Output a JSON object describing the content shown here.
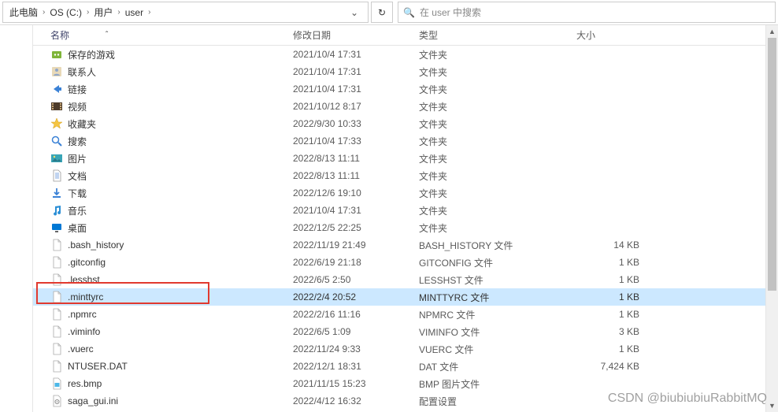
{
  "breadcrumb": {
    "items": [
      "此电脑",
      "OS (C:)",
      "用户",
      "user"
    ]
  },
  "search": {
    "placeholder": "在 user 中搜索"
  },
  "columns": {
    "name": "名称",
    "date": "修改日期",
    "type": "类型",
    "size": "大小"
  },
  "selected_index": 14,
  "highlight_index": 14,
  "items": [
    {
      "icon": "savedgames",
      "name": "保存的游戏",
      "date": "2021/10/4 17:31",
      "type": "文件夹",
      "size": ""
    },
    {
      "icon": "contacts",
      "name": "联系人",
      "date": "2021/10/4 17:31",
      "type": "文件夹",
      "size": ""
    },
    {
      "icon": "links",
      "name": "链接",
      "date": "2021/10/4 17:31",
      "type": "文件夹",
      "size": ""
    },
    {
      "icon": "videos",
      "name": "视频",
      "date": "2021/10/12 8:17",
      "type": "文件夹",
      "size": ""
    },
    {
      "icon": "favorites",
      "name": "收藏夹",
      "date": "2022/9/30 10:33",
      "type": "文件夹",
      "size": ""
    },
    {
      "icon": "searches",
      "name": "搜索",
      "date": "2021/10/4 17:33",
      "type": "文件夹",
      "size": ""
    },
    {
      "icon": "pictures",
      "name": "图片",
      "date": "2022/8/13 11:11",
      "type": "文件夹",
      "size": ""
    },
    {
      "icon": "documents",
      "name": "文档",
      "date": "2022/8/13 11:11",
      "type": "文件夹",
      "size": ""
    },
    {
      "icon": "downloads",
      "name": "下载",
      "date": "2022/12/6 19:10",
      "type": "文件夹",
      "size": ""
    },
    {
      "icon": "music",
      "name": "音乐",
      "date": "2021/10/4 17:31",
      "type": "文件夹",
      "size": ""
    },
    {
      "icon": "desktop",
      "name": "桌面",
      "date": "2022/12/5 22:25",
      "type": "文件夹",
      "size": ""
    },
    {
      "icon": "file",
      "name": ".bash_history",
      "date": "2022/11/19 21:49",
      "type": "BASH_HISTORY 文件",
      "size": "14 KB"
    },
    {
      "icon": "file",
      "name": ".gitconfig",
      "date": "2022/6/19 21:18",
      "type": "GITCONFIG 文件",
      "size": "1 KB"
    },
    {
      "icon": "file",
      "name": ".lesshst",
      "date": "2022/6/5 2:50",
      "type": "LESSHST 文件",
      "size": "1 KB"
    },
    {
      "icon": "file",
      "name": ".minttyrc",
      "date": "2022/2/4 20:52",
      "type": "MINTTYRC 文件",
      "size": "1 KB"
    },
    {
      "icon": "file",
      "name": ".npmrc",
      "date": "2022/2/16 11:16",
      "type": "NPMRC 文件",
      "size": "1 KB"
    },
    {
      "icon": "file",
      "name": ".viminfo",
      "date": "2022/6/5 1:09",
      "type": "VIMINFO 文件",
      "size": "3 KB"
    },
    {
      "icon": "file",
      "name": ".vuerc",
      "date": "2022/11/24 9:33",
      "type": "VUERC 文件",
      "size": "1 KB"
    },
    {
      "icon": "file",
      "name": "NTUSER.DAT",
      "date": "2022/12/1 18:31",
      "type": "DAT 文件",
      "size": "7,424 KB"
    },
    {
      "icon": "bmp",
      "name": "res.bmp",
      "date": "2021/11/15 15:23",
      "type": "BMP 图片文件",
      "size": ""
    },
    {
      "icon": "ini",
      "name": "saga_gui.ini",
      "date": "2022/4/12 16:32",
      "type": "配置设置",
      "size": ""
    }
  ],
  "watermark": "CSDN @biubiubiuRabbitMQ"
}
